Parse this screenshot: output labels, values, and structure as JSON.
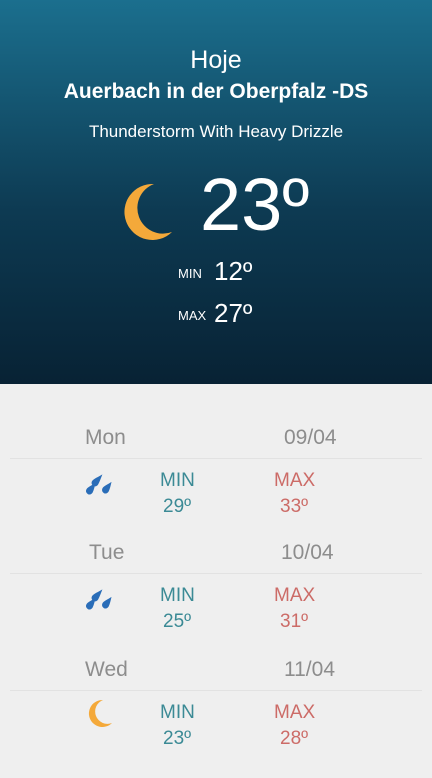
{
  "current": {
    "day_label": "Hoje",
    "city": "Auerbach in der Oberpfalz -DS",
    "condition": "Thunderstorm With Heavy Drizzle",
    "icon": "moon-icon",
    "temperature": "23º",
    "min_label": "MIN",
    "min_value": "12º",
    "max_label": "MAX",
    "max_value": "27º"
  },
  "forecast": [
    {
      "day": "Mon",
      "date": "09/04",
      "icon": "rain-drops-icon",
      "min_label": "MIN",
      "min": "29º",
      "max_label": "MAX",
      "max": "33º"
    },
    {
      "day": "Tue",
      "date": "10/04",
      "icon": "rain-drops-icon",
      "min_label": "MIN",
      "min": "25º",
      "max_label": "MAX",
      "max": "31º"
    },
    {
      "day": "Wed",
      "date": "11/04",
      "icon": "moon-icon",
      "min_label": "MIN",
      "min": "23º",
      "max_label": "MAX",
      "max": "28º"
    }
  ],
  "colors": {
    "header_top": "#1b6f8e",
    "header_bottom": "#082234",
    "moon": "#f4a93a",
    "rain": "#2a6db8",
    "min_text": "#3b8a95",
    "max_text": "#cc6b67"
  }
}
